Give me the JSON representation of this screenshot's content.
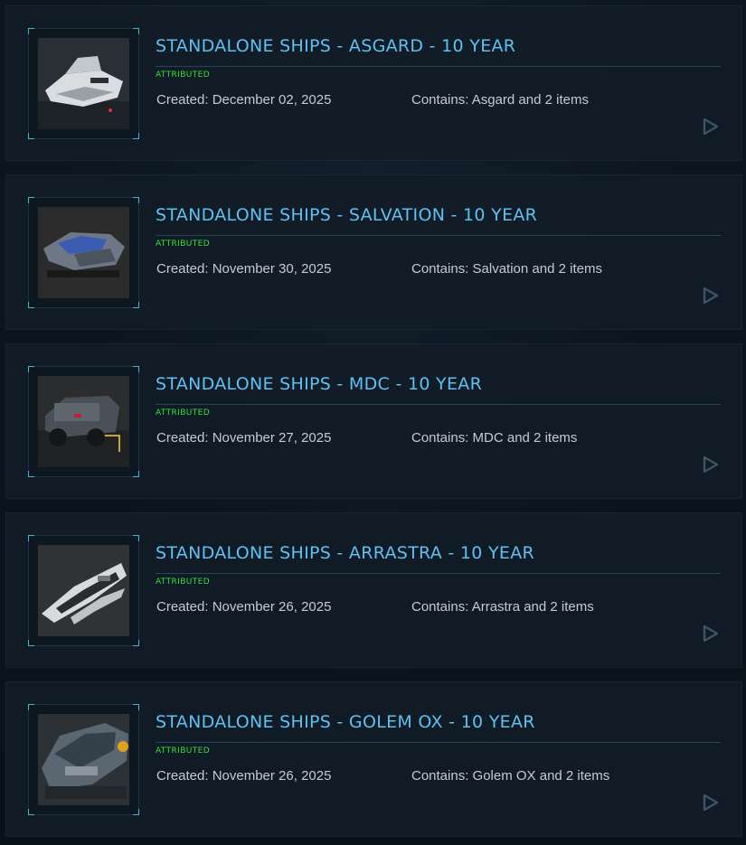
{
  "pledges": [
    {
      "title": "STANDALONE SHIPS - ASGARD - 10 YEAR",
      "badge": "ATTRIBUTED",
      "created": "Created: December 02, 2025",
      "contains": "Contains: Asgard and 2 items",
      "thumbnail": "asgard-ship-image"
    },
    {
      "title": "STANDALONE SHIPS - SALVATION - 10 YEAR",
      "badge": "ATTRIBUTED",
      "created": "Created: November 30, 2025",
      "contains": "Contains: Salvation and 2 items",
      "thumbnail": "salvation-ship-image"
    },
    {
      "title": "STANDALONE SHIPS - MDC - 10 YEAR",
      "badge": "ATTRIBUTED",
      "created": "Created: November 27, 2025",
      "contains": "Contains: MDC and 2 items",
      "thumbnail": "mdc-vehicle-image"
    },
    {
      "title": "STANDALONE SHIPS - ARRASTRA - 10 YEAR",
      "badge": "ATTRIBUTED",
      "created": "Created: November 26, 2025",
      "contains": "Contains: Arrastra and 2 items",
      "thumbnail": "arrastra-ship-image"
    },
    {
      "title": "STANDALONE SHIPS - GOLEM OX - 10 YEAR",
      "badge": "ATTRIBUTED",
      "created": "Created: November 26, 2025",
      "contains": "Contains: Golem OX and 2 items",
      "thumbnail": "golem-ox-ship-image"
    }
  ],
  "colors": {
    "title": "#5ec1f2",
    "badge": "#36e13c",
    "meta": "#c3ccd4",
    "frame_corner": "#3fb8d4",
    "play_icon": "#3b5567"
  },
  "icons": {
    "expand": "play-triangle-icon"
  }
}
